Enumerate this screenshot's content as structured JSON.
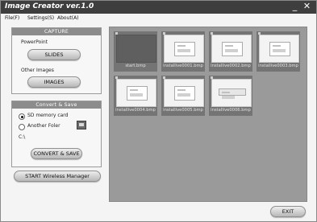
{
  "window": {
    "title": "Image Creator ver.1.0",
    "minimize_glyph": "_",
    "close_glyph": "✕"
  },
  "menu": {
    "items": [
      {
        "label": "File(F)"
      },
      {
        "label": "Settings(S)"
      },
      {
        "label": "About(A)"
      }
    ]
  },
  "capture": {
    "header": "CAPTURE",
    "powerpoint_label": "PowerPoint",
    "slides_button": "SLIDES",
    "other_label": "Other Images",
    "images_button": "IMAGES"
  },
  "convert": {
    "header": "Convert & Save",
    "option_sd": "SD memory card",
    "option_folder": "Another Foler",
    "selected": "SD memory card",
    "path": "C:\\",
    "button": "CONVERT & SAVE"
  },
  "wireless_button": "START Wireless Manager",
  "exit_button": "EXIT",
  "thumbnails": [
    {
      "file": "start.bmp"
    },
    {
      "file": "installive0001.bmp"
    },
    {
      "file": "installive0002.bmp"
    },
    {
      "file": "installive0003.bmp"
    },
    {
      "file": "installive0004.bmp"
    },
    {
      "file": "installive0005.bmp"
    },
    {
      "file": "installive0006.bmp"
    }
  ],
  "colors": {
    "titlebar": "#3e3e3e",
    "gallery_bg": "#9a9a9a",
    "panel_header": "#8c8c8c"
  }
}
